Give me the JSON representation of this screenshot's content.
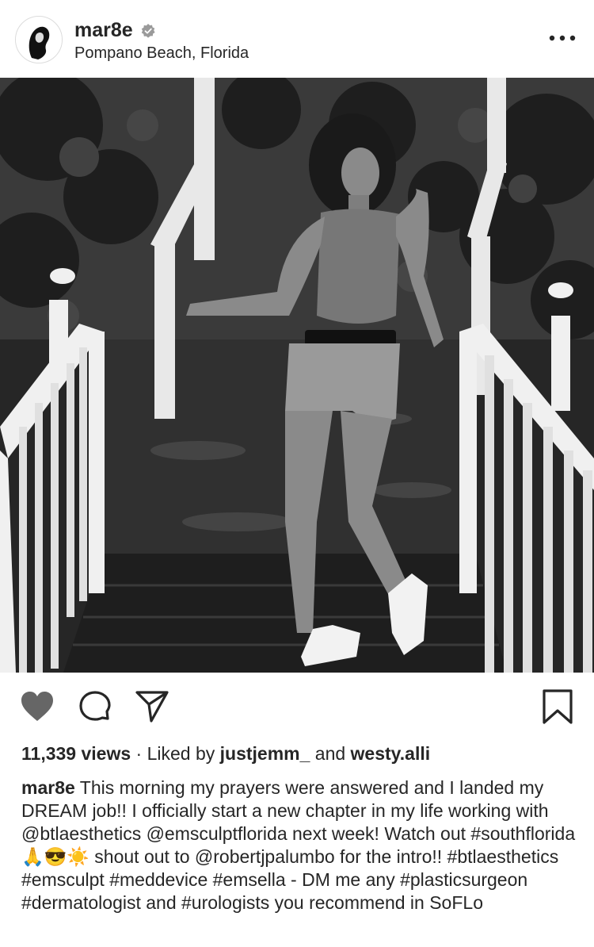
{
  "post": {
    "username": "mar8e",
    "location": "Pompano Beach, Florida",
    "views": "11,339 views",
    "liked_prefix": "· Liked by ",
    "liked_user_1": "justjemm_",
    "liked_and": "and",
    "liked_user_2": "westy.alli",
    "caption_username": "mar8e",
    "caption_text": "This morning my prayers were answered and I landed my DREAM job!! I officially start a new chapter in my life working with @btlaesthetics @emsculptflorida next week! Watch out #southflorida 🙏😎☀️ shout out to @robertjpalumbo for the intro!! #btlaesthetics #emsculpt #meddevice #emsella - DM me any #plasticsurgeon #dermatologist and #urologists you recommend in SoFLo"
  },
  "icons": {
    "verified": "verified-badge-icon",
    "more": "more-options-icon",
    "like": "heart-icon",
    "comment": "comment-icon",
    "share": "share-icon",
    "save": "bookmark-icon"
  },
  "colors": {
    "text": "#262626",
    "icon_fill": "#666666"
  }
}
